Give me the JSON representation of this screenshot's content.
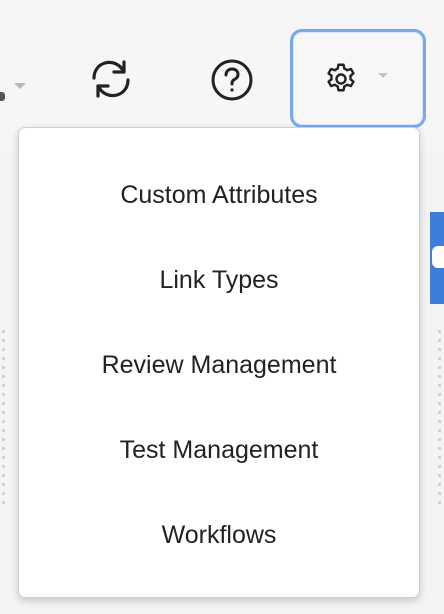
{
  "toolbar": {
    "buttons": [
      {
        "icon": "sync-icon"
      },
      {
        "icon": "help-icon"
      },
      {
        "icon": "gear-icon"
      }
    ],
    "accent_color": "#7aa8ee"
  },
  "settings_menu": {
    "items": [
      {
        "label": "Custom Attributes"
      },
      {
        "label": "Link Types"
      },
      {
        "label": "Review Management"
      },
      {
        "label": "Test Management"
      },
      {
        "label": "Workflows"
      }
    ]
  }
}
